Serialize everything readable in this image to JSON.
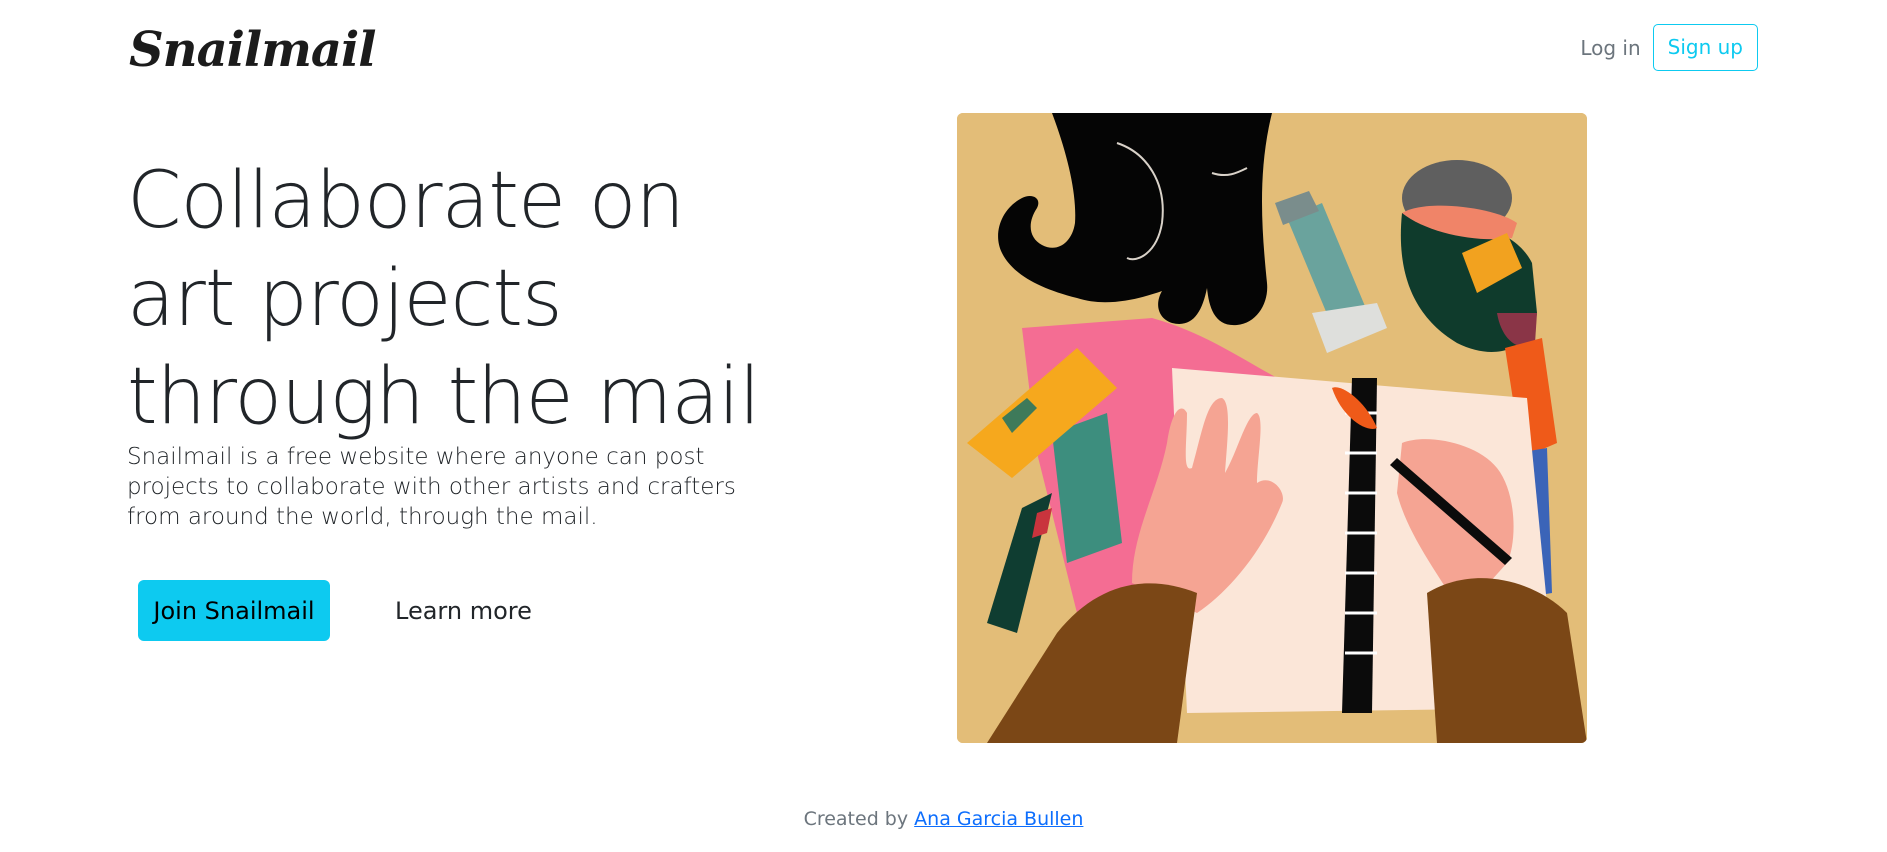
{
  "brand": {
    "name": "Snailmail"
  },
  "nav": {
    "login_label": "Log in",
    "signup_label": "Sign up"
  },
  "hero": {
    "title": "Collaborate on art projects through the mail",
    "lead": "Snailmail is a free website where anyone can post projects to collaborate with other artists and crafters from around the world, through the mail.",
    "primary_button": "Join Snailmail",
    "secondary_button": "Learn more"
  },
  "footer": {
    "prefix": "Created by",
    "author_link": "Ana Garcia Bullen"
  },
  "colors": {
    "accent": "#0dcaf0",
    "link": "#0d6efd",
    "muted_text": "#6c757d",
    "illustration_background": "#e3bd78"
  }
}
